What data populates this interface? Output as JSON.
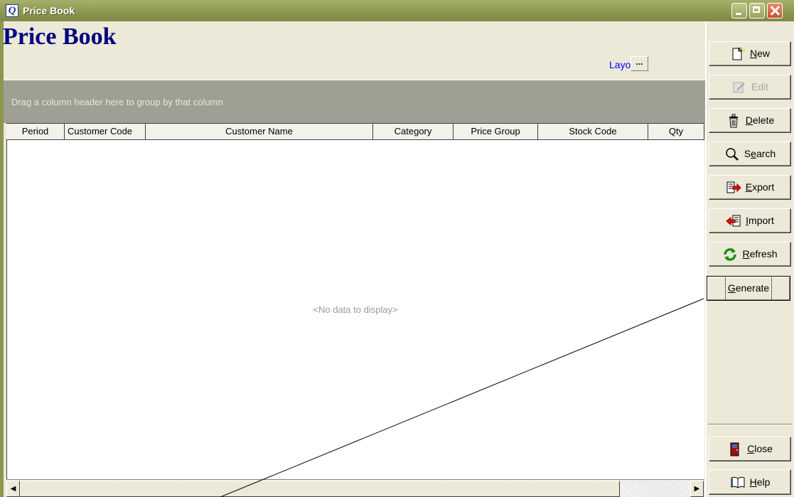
{
  "window": {
    "icon_letter": "Q",
    "title": "Price Book"
  },
  "header": {
    "page_title": "Price Book",
    "layout_label": "Layout",
    "layout_button": "..."
  },
  "grid": {
    "group_hint": "Drag a column header here to group by that column",
    "columns": [
      "Period",
      "Customer Code",
      "Customer Name",
      "Category",
      "Price Group",
      "Stock Code",
      "Qty"
    ],
    "empty_text": "<No data to display>"
  },
  "toolbar": {
    "new": {
      "mnemonic": "N",
      "rest": "ew"
    },
    "edit": {
      "mnemonic": "E",
      "rest": "dit"
    },
    "delete": {
      "mnemonic": "D",
      "rest": "elete"
    },
    "search": {
      "pre": "S",
      "mnemonic": "e",
      "rest": "arch"
    },
    "export": {
      "mnemonic": "E",
      "rest": "xport"
    },
    "import": {
      "mnemonic": "I",
      "rest": "mport"
    },
    "refresh": {
      "mnemonic": "R",
      "rest": "efresh"
    },
    "generate": {
      "mnemonic": "G",
      "rest": "enerate"
    },
    "close": {
      "mnemonic": "C",
      "rest": "lose"
    },
    "help": {
      "mnemonic": "H",
      "rest": "elp"
    }
  },
  "colors": {
    "title_blue": "#000080",
    "link_blue": "#0000ff",
    "group_panel": "#a09f93",
    "face": "#ece9d8"
  },
  "scroll": {
    "left_arrow": "◀",
    "right_arrow": "▶"
  }
}
